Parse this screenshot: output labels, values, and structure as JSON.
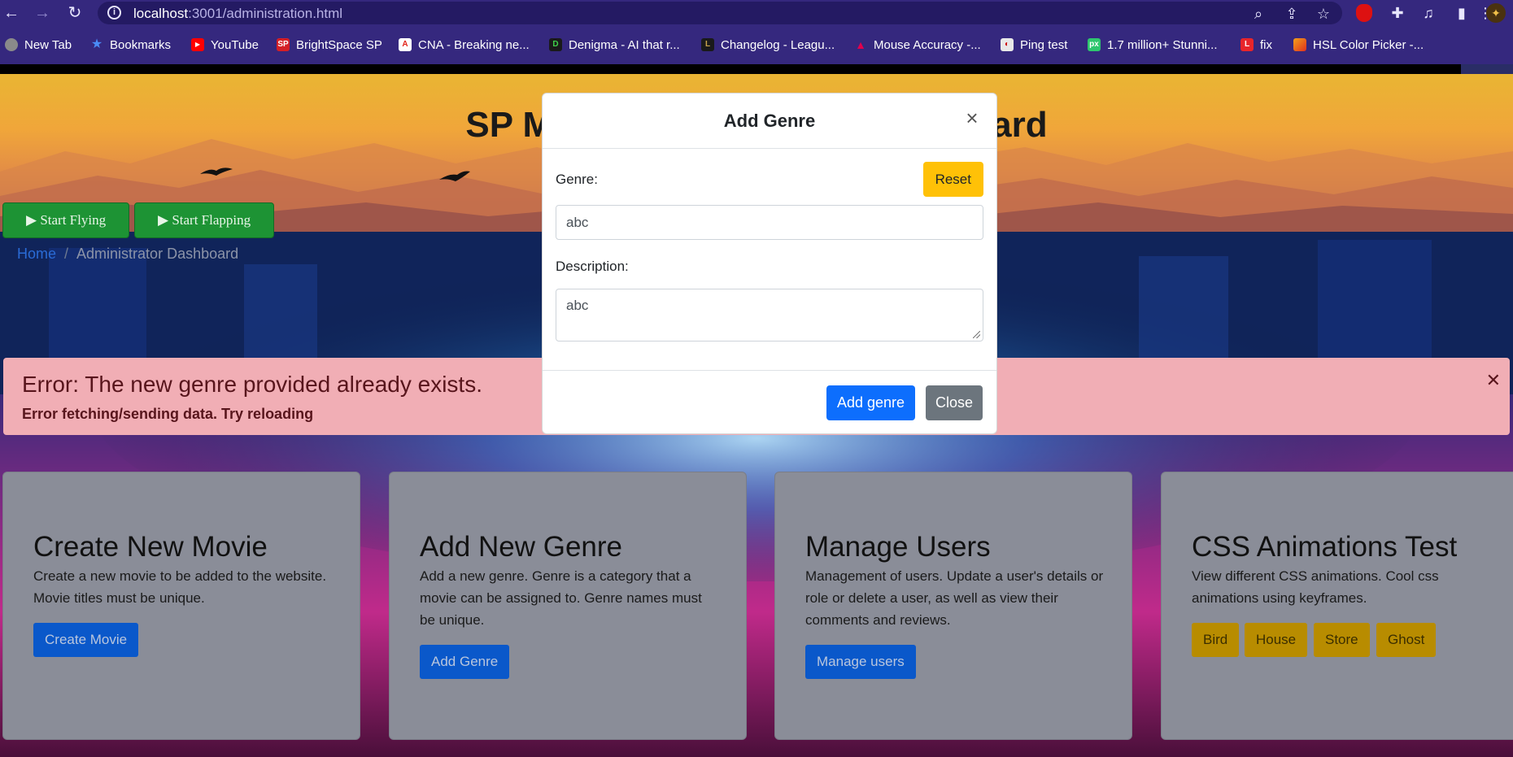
{
  "browser": {
    "url_host": "localhost",
    "url_rest": ":3001/administration.html",
    "bookmarks": [
      {
        "label": "New Tab",
        "icon": "globe-icon",
        "color": "#8a8a8a"
      },
      {
        "label": "Bookmarks",
        "icon": "star-icon",
        "color": "#4a8cf7"
      },
      {
        "label": "YouTube",
        "icon": "youtube-icon",
        "color": "#ff0000"
      },
      {
        "label": "BrightSpace SP",
        "icon": "sp-icon",
        "color": "#d41f26"
      },
      {
        "label": "CNA - Breaking ne...",
        "icon": "cna-icon",
        "color": "#e2231a"
      },
      {
        "label": "Denigma - AI that r...",
        "icon": "denigma-icon",
        "color": "#1a1a1a"
      },
      {
        "label": "Changelog - Leagu...",
        "icon": "league-icon",
        "color": "#c8a44a"
      },
      {
        "label": "Mouse Accuracy -...",
        "icon": "mouse-accuracy-icon",
        "color": "#e0004d"
      },
      {
        "label": "Ping test",
        "icon": "ping-icon",
        "color": "#e8e8e8"
      },
      {
        "label": "1.7 million+ Stunni...",
        "icon": "pixabay-icon",
        "color": "#2ec66e"
      },
      {
        "label": "fix",
        "icon": "l-icon",
        "color": "#e8252a"
      },
      {
        "label": "HSL Color Picker -...",
        "icon": "color-picker-icon",
        "color": "#f2a11a"
      }
    ]
  },
  "page": {
    "hero_title_left": "SP M",
    "hero_title_right": "ard",
    "fly_buttons": [
      "▶ Start Flying",
      "▶ Start Flapping"
    ],
    "breadcrumb": {
      "home": "Home",
      "separator": "/",
      "current": "Administrator Dashboard"
    },
    "alert": {
      "title": "Error: The new genre provided already exists.",
      "subtitle": "Error fetching/sending data. Try reloading"
    },
    "cards": [
      {
        "title": "Create New Movie",
        "text": "Create a new movie to be added to the website. Movie titles must be unique.",
        "button": "Create Movie"
      },
      {
        "title": "Add New Genre",
        "text": "Add a new genre. Genre is a category that a movie can be assigned to. Genre names must be unique.",
        "button": "Add Genre"
      },
      {
        "title": "Manage Users",
        "text": "Management of users. Update a user's details or role or delete a user, as well as view their comments and reviews.",
        "button": "Manage users"
      },
      {
        "title": "CSS Animations Test",
        "text": "View different CSS animations. Cool css animations using keyframes.",
        "buttons": [
          "Bird",
          "House",
          "Store",
          "Ghost"
        ]
      }
    ]
  },
  "modal": {
    "title": "Add Genre",
    "genre_label": "Genre:",
    "reset_label": "Reset",
    "genre_value": "abc",
    "description_label": "Description:",
    "description_value": "abc",
    "submit_label": "Add genre",
    "close_label": "Close"
  }
}
